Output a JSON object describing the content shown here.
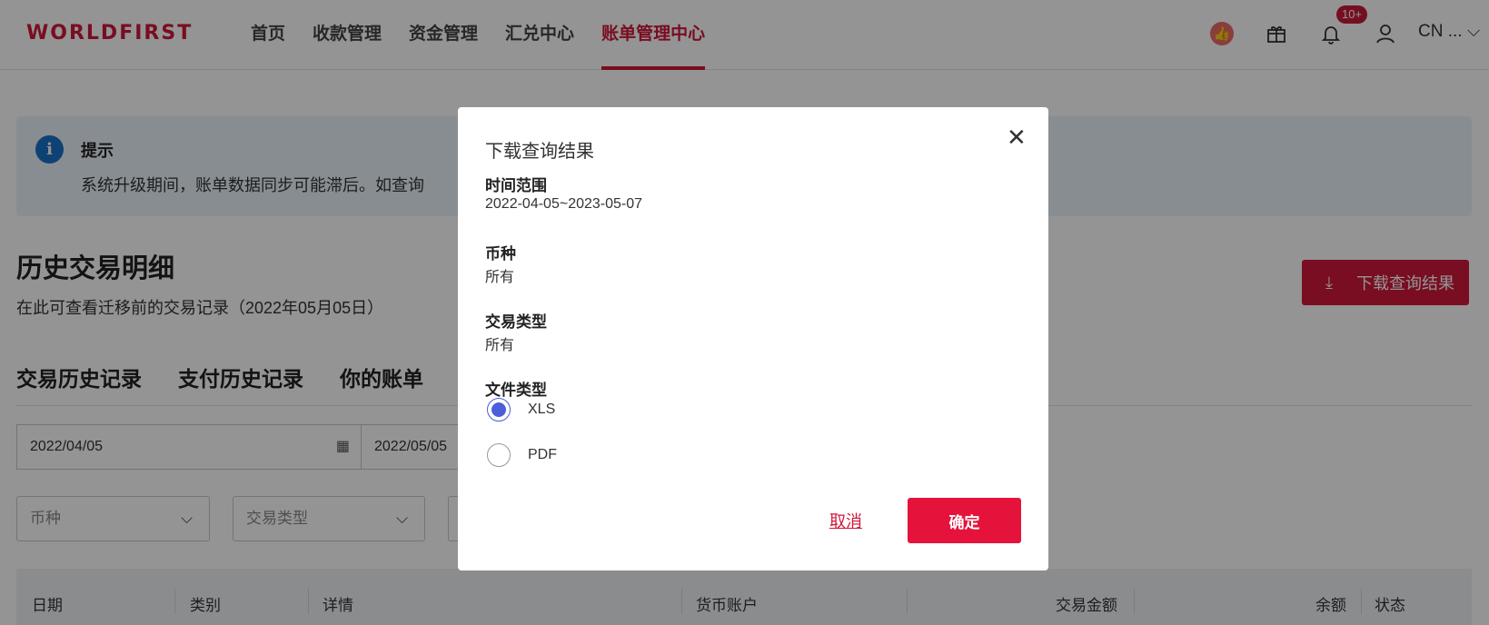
{
  "header": {
    "logo": "WORLDFIRST",
    "nav": [
      "首页",
      "收款管理",
      "资金管理",
      "汇兑中心",
      "账单管理中心"
    ],
    "active_nav": "账单管理中心",
    "notification_badge": "10+",
    "lang": "CN ...",
    "brand_color": "#d0173a"
  },
  "alert": {
    "title": "提示",
    "text": "系统升级期间，账单数据同步可能滞后。如查询"
  },
  "page": {
    "title": "历史交易明细",
    "subtitle": "在此可查看迁移前的交易记录（2022年05月05日）",
    "download_button": "下载查询结果"
  },
  "tabs": [
    "交易历史记录",
    "支付历史记录",
    "你的账单"
  ],
  "filters": {
    "start_date": "2022/04/05",
    "end_date": "2022/05/05",
    "currency_placeholder": "币种",
    "type_placeholder": "交易类型"
  },
  "table": {
    "headers": [
      "日期",
      "类别",
      "详情",
      "货币账户",
      "交易金额",
      "余额",
      "状态"
    ]
  },
  "modal": {
    "title": "下载查询结果",
    "fields": [
      {
        "label": "时间范围",
        "value": "2022-04-05~2023-05-07"
      },
      {
        "label": "币种",
        "value": "所有"
      },
      {
        "label": "交易类型",
        "value": "所有"
      }
    ],
    "file_type_label": "文件类型",
    "file_types": [
      "XLS",
      "PDF"
    ],
    "selected_file_type": "XLS",
    "cancel_label": "取消",
    "confirm_label": "确定"
  }
}
